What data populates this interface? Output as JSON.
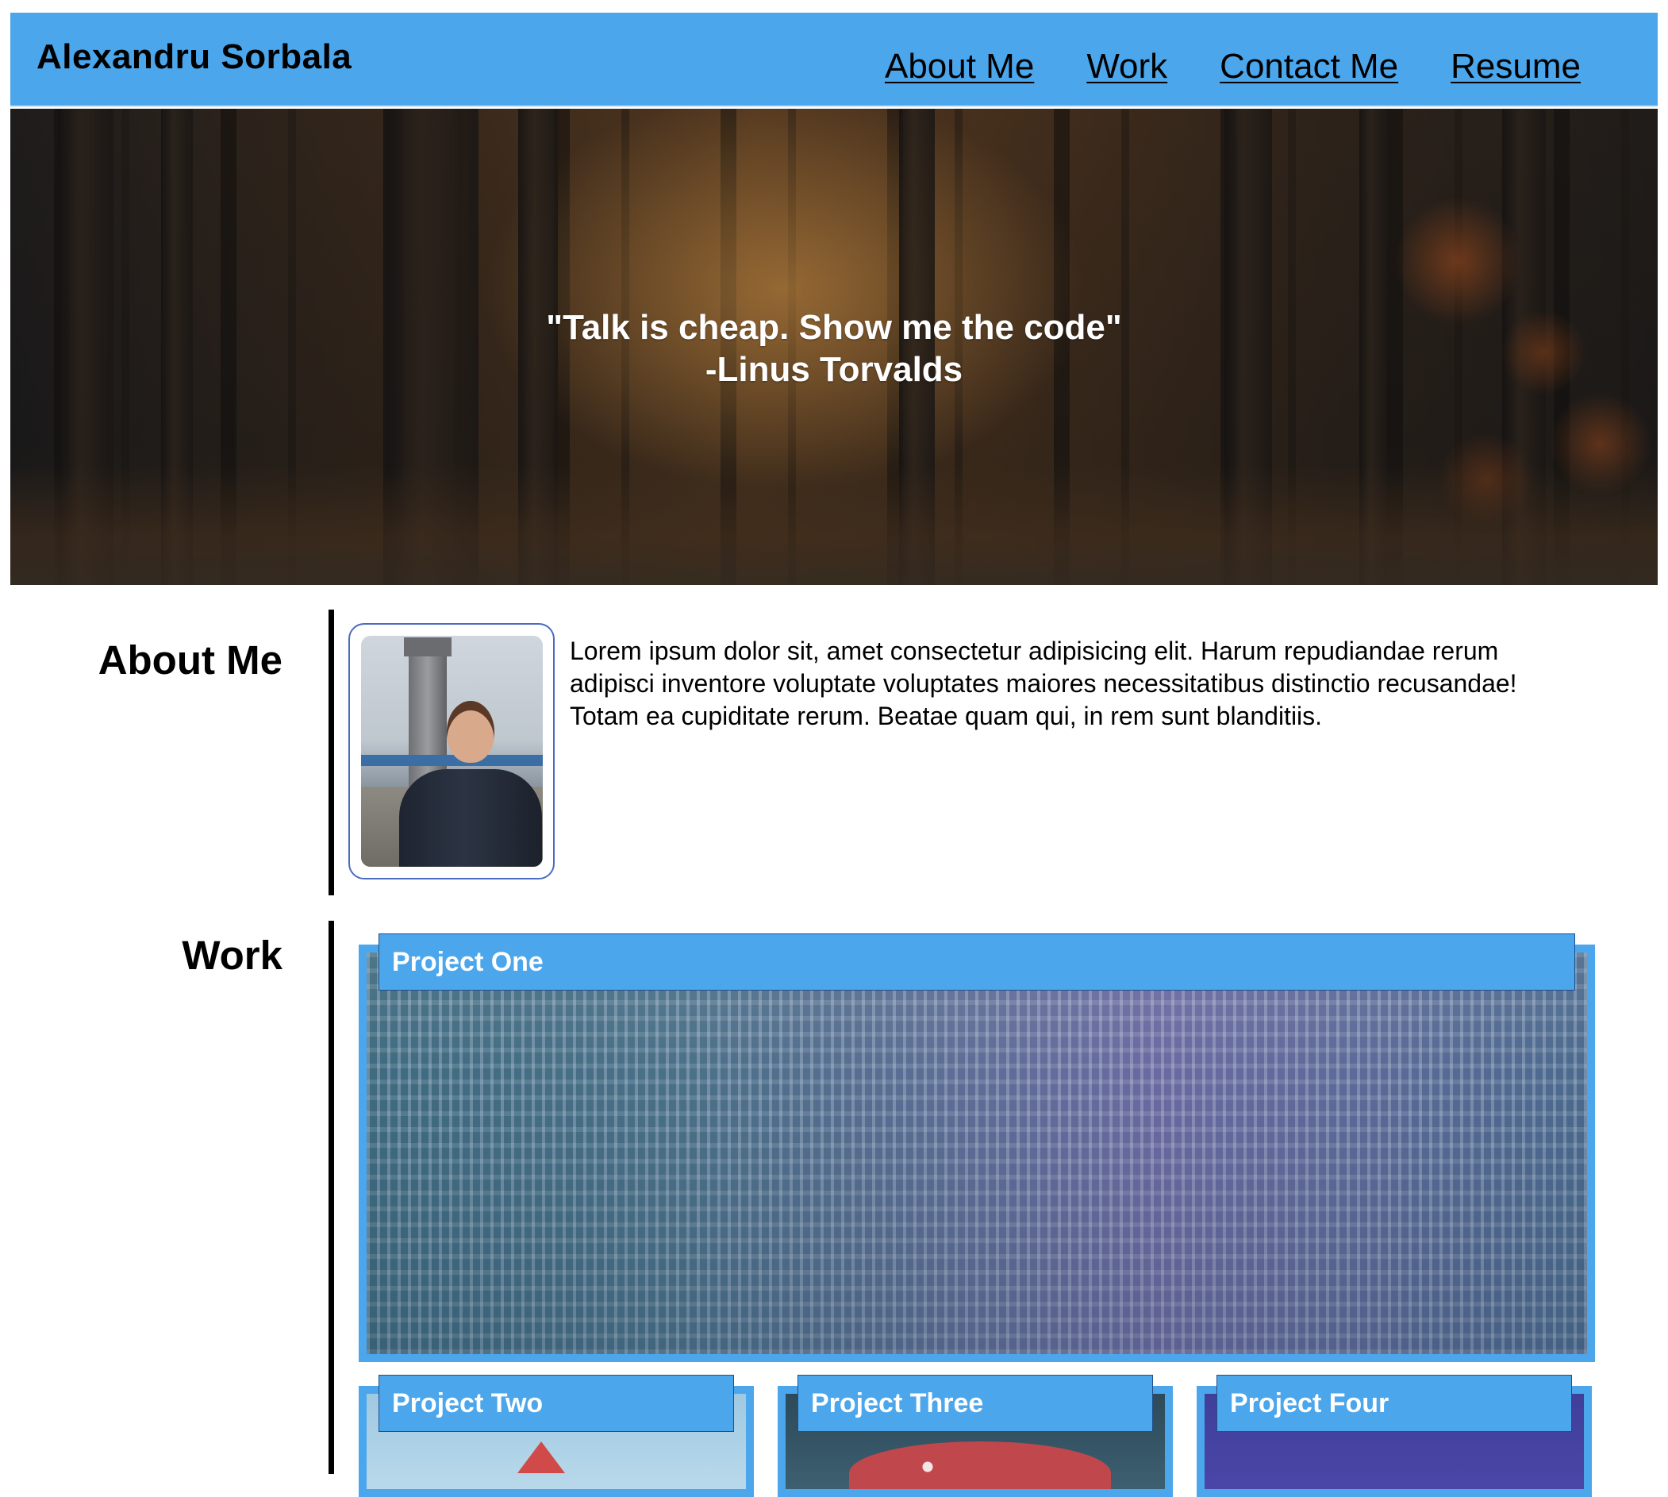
{
  "header": {
    "site_name": "Alexandru Sorbala",
    "nav": [
      "About Me",
      "Work",
      "Contact Me",
      "Resume"
    ]
  },
  "hero": {
    "quote_line1": "\"Talk is cheap. Show me the code\"",
    "quote_line2": "-Linus Torvalds"
  },
  "about": {
    "title": "About Me",
    "text": "Lorem ipsum dolor sit, amet consectetur adipisicing elit. Harum repudiandae rerum adipisci inventore voluptate voluptates maiores necessitatibus distinctio recusandae! Totam ea cupiditate rerum. Beatae quam qui, in rem sunt blanditiis."
  },
  "work": {
    "title": "Work",
    "projects": [
      "Project One",
      "Project Two",
      "Project Three",
      "Project Four"
    ]
  },
  "colors": {
    "accent": "#4ba6ec",
    "label_border": "#1f4f8a"
  }
}
